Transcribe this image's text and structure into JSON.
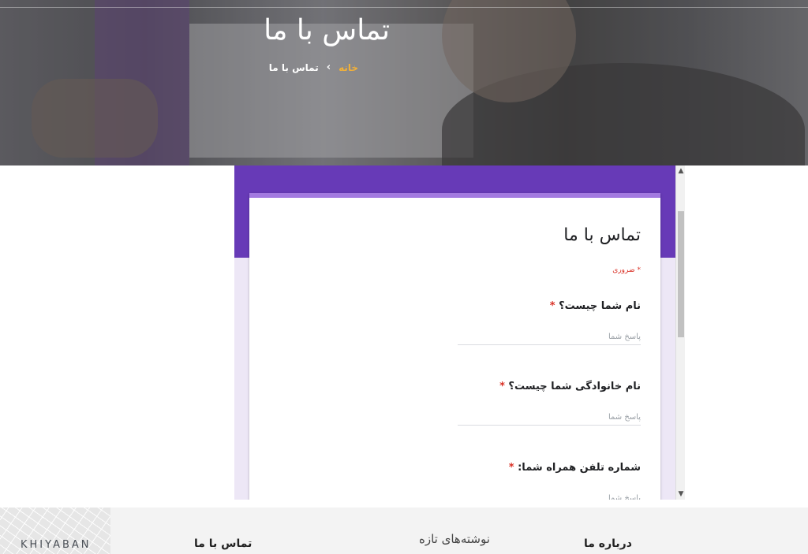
{
  "hero": {
    "title": "تماس با ما",
    "breadcrumb": {
      "home": "خانه",
      "separator": "›",
      "current": "تماس با ما"
    }
  },
  "form": {
    "title": "تماس با ما",
    "required_note": "* ضروری",
    "questions": [
      {
        "label": "نام شما چیست؟",
        "required_mark": "*",
        "placeholder": "پاسخ شما"
      },
      {
        "label": "نام خانوادگی شما چیست؟",
        "required_mark": "*",
        "placeholder": "پاسخ شما"
      },
      {
        "label": "شماره تلفن همراه شما:",
        "required_mark": "*",
        "placeholder": "پاسخ شما"
      }
    ],
    "scroll_up_icon": "▲",
    "scroll_down_icon": "▼"
  },
  "footer": {
    "logo": "KHIYABAN",
    "columns": [
      {
        "title": "تماس با ما"
      },
      {
        "title": "نوشته‌های تازه"
      },
      {
        "title": "درباره ما"
      }
    ]
  },
  "colors": {
    "form_accent": "#673ab7",
    "form_background": "#ede7f6",
    "required": "#d93025",
    "breadcrumb_home": "#f0b03a"
  }
}
